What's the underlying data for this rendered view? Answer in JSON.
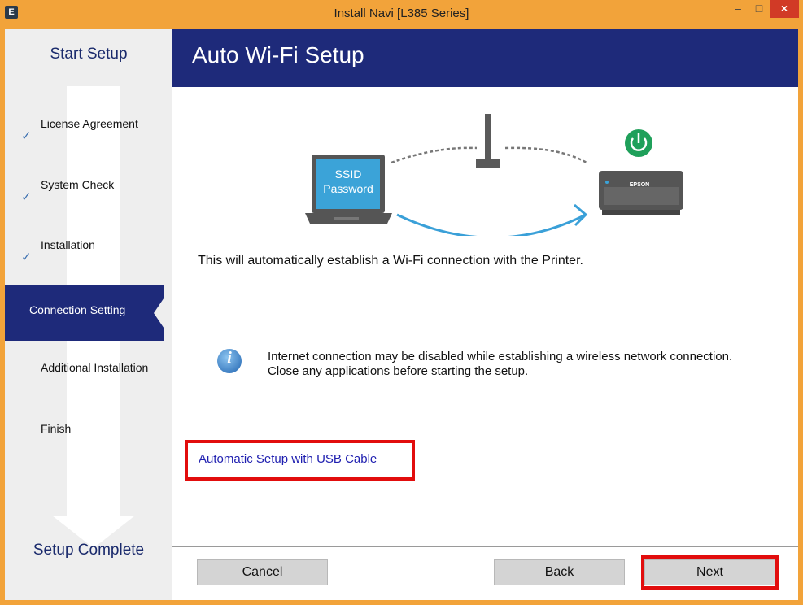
{
  "window": {
    "app_icon": "E",
    "title": "Install Navi [L385 Series]",
    "minimize": "–",
    "maximize": "□",
    "close": "×"
  },
  "sidebar": {
    "top_label": "Start Setup",
    "bottom_label": "Setup Complete",
    "steps": [
      {
        "label": "License Agreement",
        "done": true
      },
      {
        "label": "System Check",
        "done": true
      },
      {
        "label": "Installation",
        "done": true
      },
      {
        "label": "Connection Setting",
        "active": true
      },
      {
        "label": "Additional Installation"
      },
      {
        "label": "Finish"
      }
    ],
    "check_glyph": "✓"
  },
  "header": {
    "title": "Auto Wi-Fi Setup"
  },
  "illustration": {
    "laptop_line1": "SSID",
    "laptop_line2": "Password",
    "printer_brand": "EPSON",
    "colors": {
      "laptop_screen": "#3ba3d8",
      "arrow": "#3aa0d8",
      "power": "#1fa05a"
    }
  },
  "main": {
    "description": "This will automatically establish a Wi-Fi connection with the Printer.",
    "info_glyph": "i",
    "info_text": "Internet connection may be disabled while establishing a wireless network connection. Close any applications before starting the setup.",
    "usb_link": "Automatic Setup with USB Cable"
  },
  "footer": {
    "cancel": "Cancel",
    "back": "Back",
    "next": "Next"
  },
  "colors": {
    "accent": "#1e2a7a",
    "highlight": "#e20d0d",
    "frame": "#f2a33a"
  }
}
